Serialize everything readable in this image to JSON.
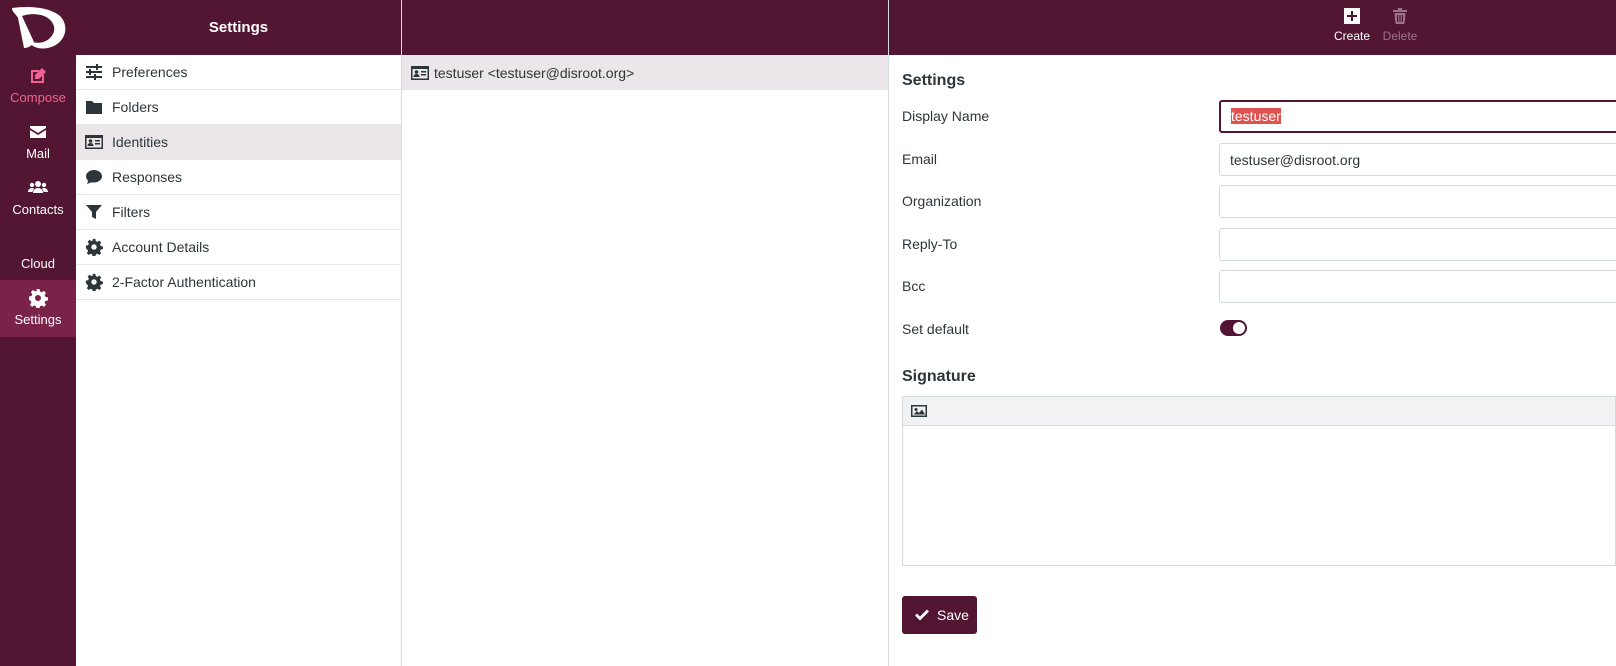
{
  "rail": {
    "items": [
      {
        "label": "Compose",
        "icon": "pencil-square-icon"
      },
      {
        "label": "Mail",
        "icon": "envelope-icon"
      },
      {
        "label": "Contacts",
        "icon": "users-icon"
      },
      {
        "label": "Cloud",
        "icon": ""
      },
      {
        "label": "Settings",
        "icon": "gear-icon"
      }
    ],
    "active": "Settings"
  },
  "settings": {
    "title": "Settings",
    "items": [
      {
        "label": "Preferences",
        "icon": "sliders-icon"
      },
      {
        "label": "Folders",
        "icon": "folder-icon"
      },
      {
        "label": "Identities",
        "icon": "id-card-icon"
      },
      {
        "label": "Responses",
        "icon": "comment-icon"
      },
      {
        "label": "Filters",
        "icon": "filter-icon"
      },
      {
        "label": "Account Details",
        "icon": "gear-icon"
      },
      {
        "label": "2-Factor Authentication",
        "icon": "gear-icon"
      }
    ],
    "active": "Identities"
  },
  "identities": {
    "items": [
      {
        "label": "testuser <testuser@disroot.org>"
      }
    ]
  },
  "toolbar": {
    "create_label": "Create",
    "delete_label": "Delete"
  },
  "form": {
    "section_title": "Settings",
    "fields": {
      "display_name": {
        "label": "Display Name",
        "value": "testuser"
      },
      "email": {
        "label": "Email",
        "value": "testuser@disroot.org"
      },
      "organization": {
        "label": "Organization",
        "value": ""
      },
      "reply_to": {
        "label": "Reply-To",
        "value": ""
      },
      "bcc": {
        "label": "Bcc",
        "value": ""
      },
      "set_default": {
        "label": "Set default",
        "checked": true
      }
    },
    "signature_title": "Signature",
    "save_label": "Save"
  },
  "colors": {
    "brand": "#521632",
    "rail_active": "#7a2348",
    "compose_accent": "#f06292",
    "selection": "#e0524d"
  }
}
